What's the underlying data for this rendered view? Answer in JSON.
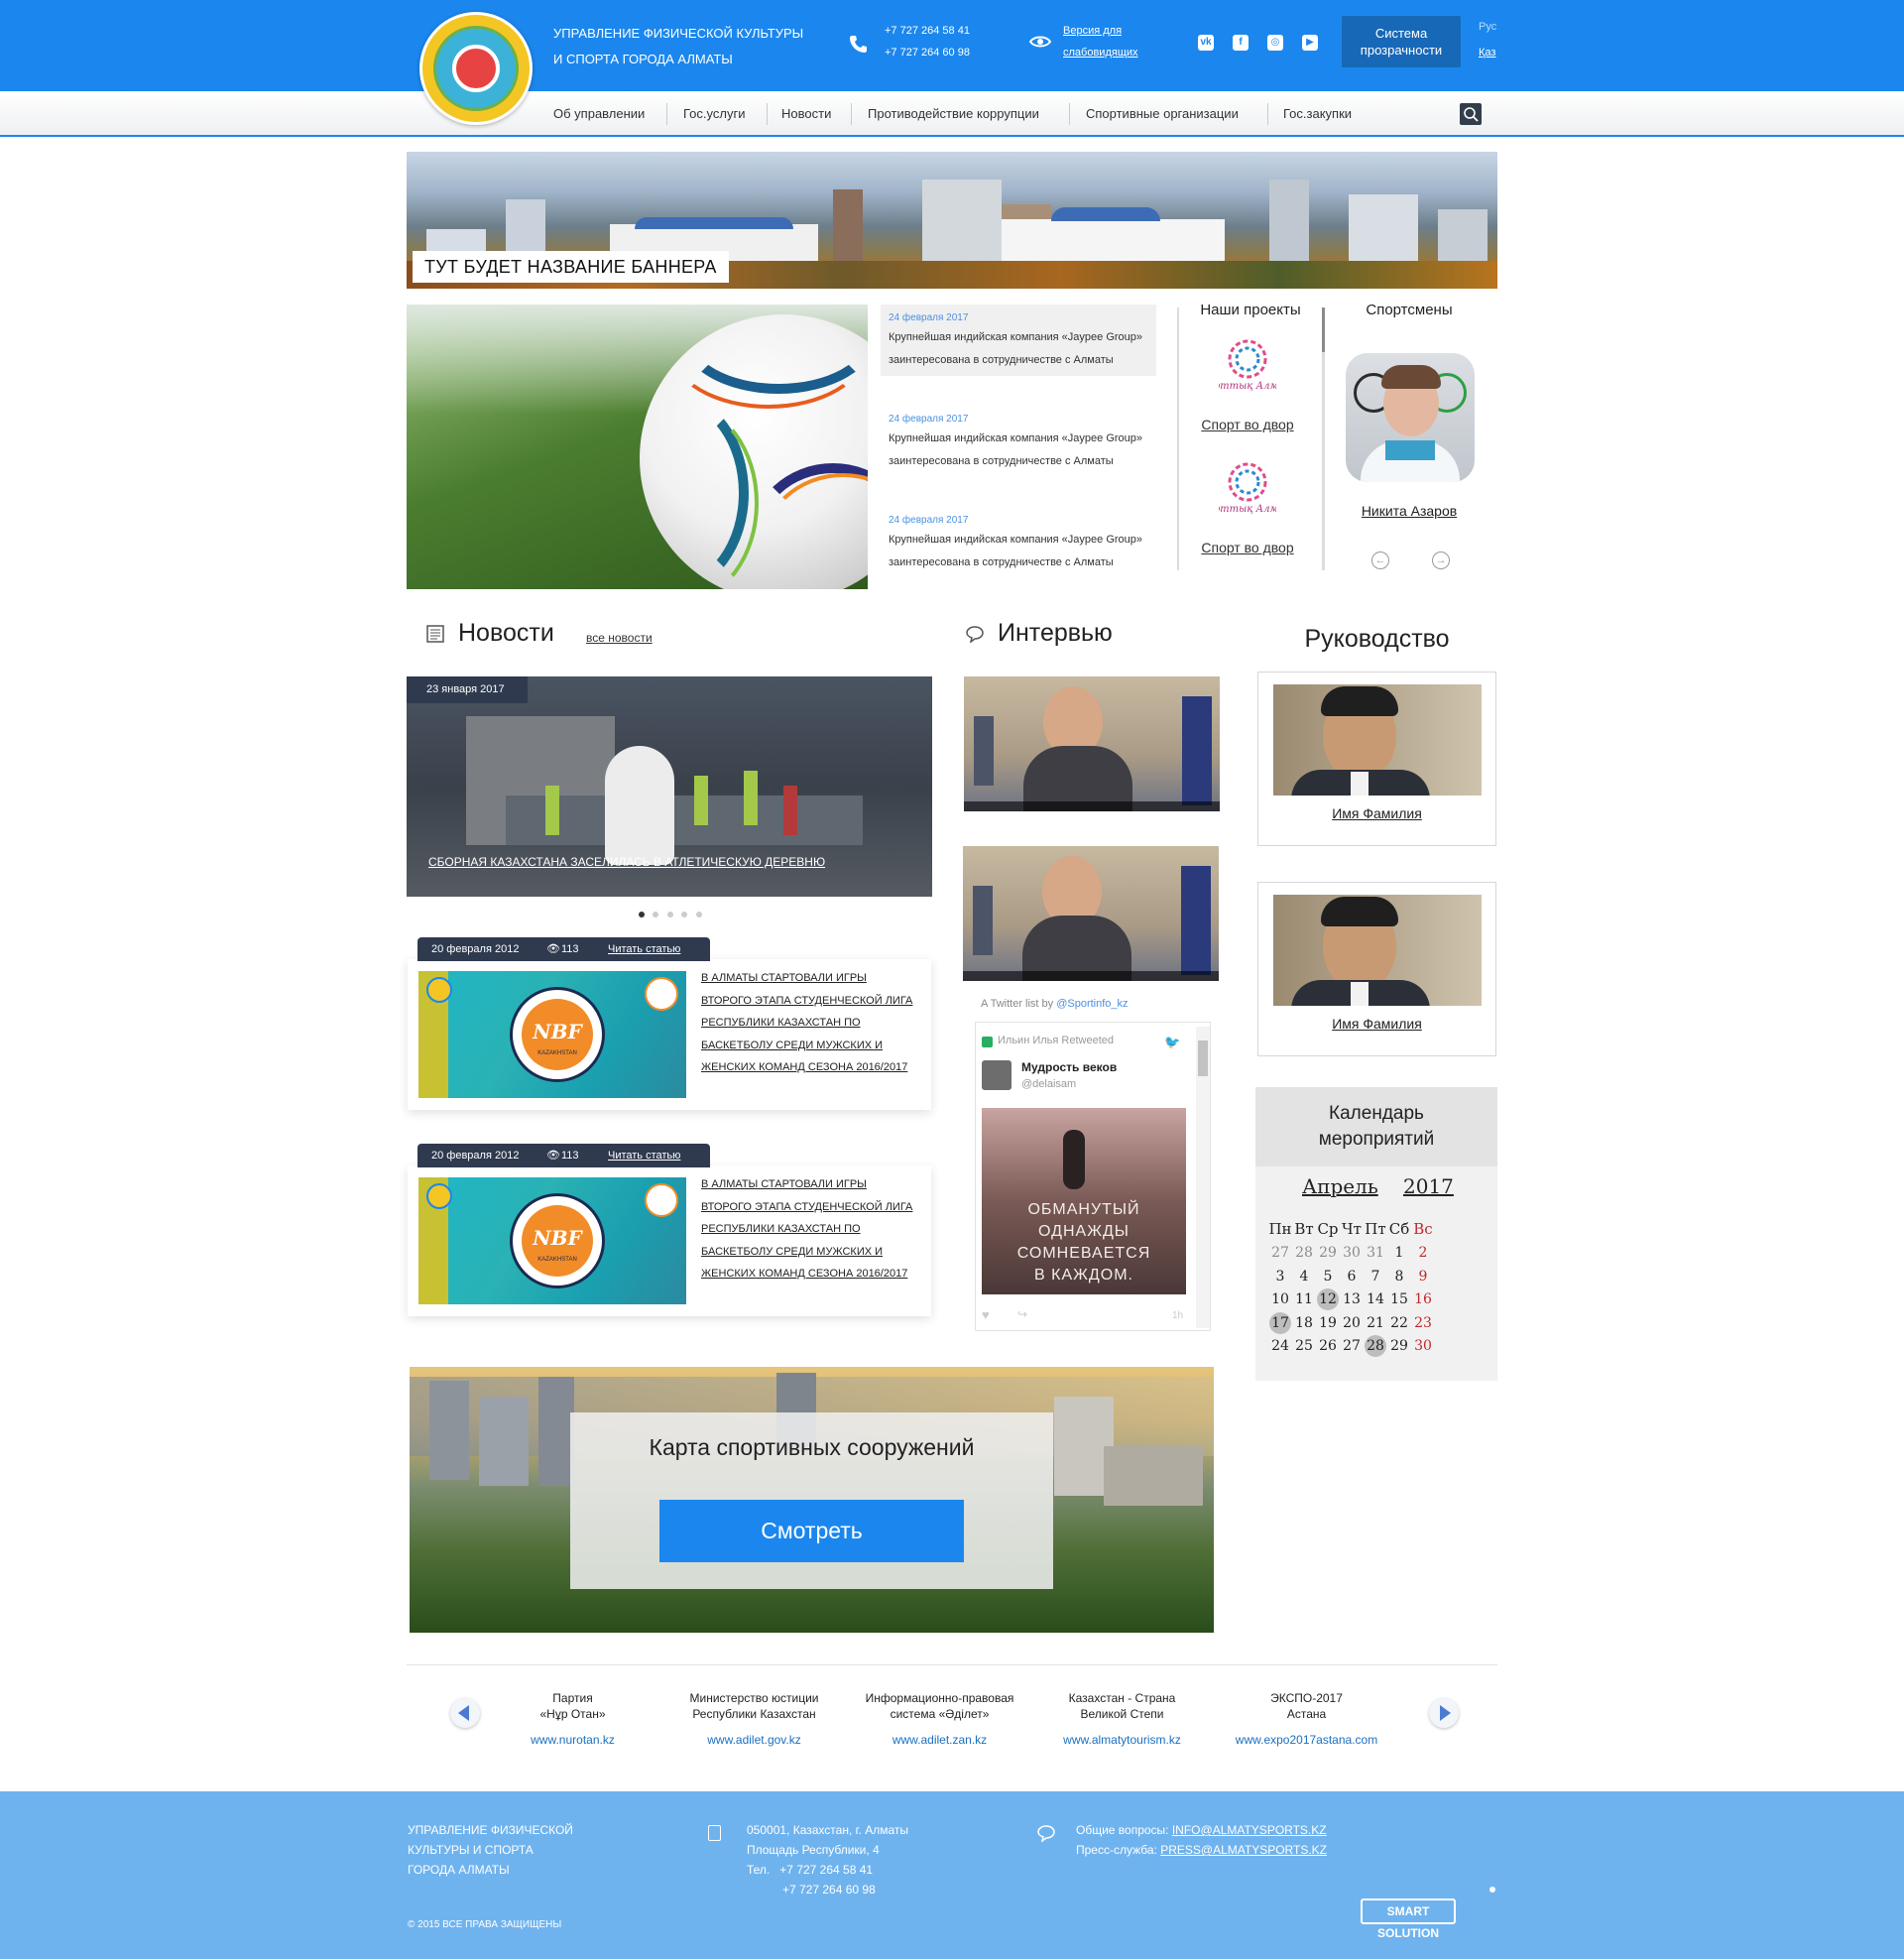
{
  "header": {
    "org_line1": "Управление физической культуры",
    "org_line2": "и спорта города Алматы",
    "phone1": "+7 727 264 58 41",
    "phone2": "+7 727 264 60 98",
    "vision_line1": "Версия для",
    "vision_line2": "слабовидящих",
    "social": [
      "vk-icon",
      "facebook-icon",
      "instagram-icon",
      "youtube-icon"
    ],
    "transparency_line1": "Система",
    "transparency_line2": "прозрачности",
    "lang_ru": "Рус",
    "lang_kz": "Қаз"
  },
  "nav": [
    "Об управлении",
    "Гос.услуги",
    "Новости",
    "Противодействие коррупции",
    "Спортивные организации",
    "Гос.закупки"
  ],
  "banner": {
    "title": "Тут будет название баннера"
  },
  "side_news": [
    {
      "date": "24 февраля 2017",
      "line1": "Крупнейшая индийская компания «Jaypee Group»",
      "line2": "заинтересована в сотрудничестве с Алматы"
    },
    {
      "date": "24 февраля 2017",
      "line1": "Крупнейшая индийская компания «Jaypee Group»",
      "line2": "заинтересована в сотрудничестве с Алматы"
    },
    {
      "date": "24 февраля 2017",
      "line1": "Крупнейшая индийская компания «Jaypee Group»",
      "line2": "заинтересована в сотрудничестве с Алматы"
    }
  ],
  "projects": {
    "title": "Наши проекты",
    "items": [
      {
        "logo_text": "Спорттық Алматы",
        "label": "Спорт во двор"
      },
      {
        "logo_text": "Спорттық Алматы",
        "label": "Спорт во двор"
      }
    ]
  },
  "athletes": {
    "title": "Спортсмены",
    "name": "Никита Азаров"
  },
  "news": {
    "title": "Новости",
    "all_link": "все новости",
    "featured_date": "23 января 2017",
    "featured_title": "Сборная Казахстана заселилась в атлетическую деревню",
    "articles": [
      {
        "date": "20 февраля 2012",
        "views": "113",
        "read": "Читать статью",
        "lines": [
          "В Алматы стартовали игры",
          "второго этапа студенческой лига",
          "Республики Казахстан по",
          "баскетболу среди мужских и",
          "женских команд сезона 2016/2017"
        ],
        "logo_text": "NBF",
        "logo_sub": "KAZAKHSTAN"
      },
      {
        "date": "20 февраля 2012",
        "views": "113",
        "read": "Читать статью",
        "lines": [
          "В Алматы стартовали игры",
          "второго этапа студенческой лига",
          "Республики Казахстан по",
          "баскетболу среди мужских и",
          "женских команд сезона 2016/2017"
        ],
        "logo_text": "NBF",
        "logo_sub": "KAZAKHSTAN"
      }
    ]
  },
  "interview": {
    "title": "Интервью",
    "twitter_caption_prefix": "A Twitter list by ",
    "twitter_handle": "@Sportinfo_kz",
    "retweet": "Ильин Илья Retweeted",
    "tweet_author": "Мудрость веков",
    "tweet_handle": "@delaisam",
    "quote_lines": [
      "ОБМАНУТЫЙ",
      "ОДНАЖДЫ",
      "СОМНЕВАЕТСЯ",
      "В КАЖДОМ."
    ],
    "time": "1h"
  },
  "management": {
    "title": "Руководство",
    "people": [
      {
        "name": "Имя Фамилия"
      },
      {
        "name": "Имя Фамилия"
      }
    ]
  },
  "calendar": {
    "title_line1": "Календарь",
    "title_line2": "мероприятий",
    "month": "Апрель",
    "year": "2017",
    "weekdays": [
      "Пн",
      "Вт",
      "Ср",
      "Чт",
      "Пт",
      "Сб",
      "Вс"
    ],
    "weeks": [
      [
        "27",
        "28",
        "29",
        "30",
        "31",
        "1",
        "2"
      ],
      [
        "3",
        "4",
        "5",
        "6",
        "7",
        "8",
        "9"
      ],
      [
        "10",
        "11",
        "12",
        "13",
        "14",
        "15",
        "16"
      ],
      [
        "17",
        "18",
        "19",
        "20",
        "21",
        "22",
        "23"
      ],
      [
        "24",
        "25",
        "26",
        "27",
        "28",
        "29",
        "30"
      ]
    ],
    "highlighted": [
      "12",
      "17",
      "28"
    ],
    "weekend_color": "#c0272d"
  },
  "map": {
    "title": "Карта спортивных сооружений",
    "button": "Смотреть"
  },
  "links": [
    {
      "line1": "Партия",
      "line2": "«Нұр Отан»",
      "url": "www.nurotan.kz"
    },
    {
      "line1": "Министерство юстиции",
      "line2": "Республики Казахстан",
      "url": "www.adilet.gov.kz"
    },
    {
      "line1": "Информационно-правовая",
      "line2": "система «Әділет»",
      "url": "www.adilet.zan.kz"
    },
    {
      "line1": "Казахстан - Страна",
      "line2": "Великой Степи",
      "url": "www.almatytourism.kz"
    },
    {
      "line1": "ЭКСПО-2017",
      "line2": "Астана",
      "url": "www.expo2017astana.com"
    }
  ],
  "footer": {
    "org_lines": [
      "Управление физической",
      "культуры и спорта",
      "города Алматы"
    ],
    "address_lines": [
      "050001, Казахстан, г. Алматы",
      "Площадь Республики, 4"
    ],
    "tel_label": "Тел.",
    "phone1": "+7 727 264 58 41",
    "phone2": "+7 727 264 60 98",
    "general_label": "Общие вопросы: ",
    "general_email": "INFO@ALMATYSPORTS.KZ",
    "press_label": "Пресс-служба: ",
    "press_email": "PRESS@ALMATYSPORTS.KZ",
    "copyright": "© 2015 ВСЕ ПРАВА ЗАЩИЩЕНЫ",
    "developer": "SMART SOLUTION"
  },
  "colors": {
    "accent": "#1b87ee",
    "footer": "#6fb3ee",
    "dark": "#2f3a4f"
  }
}
